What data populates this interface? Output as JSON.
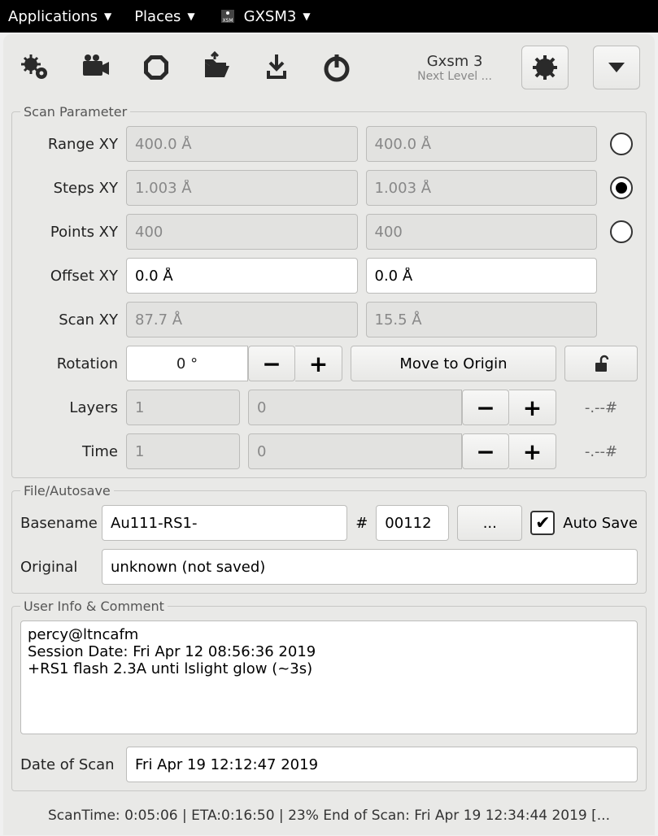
{
  "menubar": {
    "applications": "Applications",
    "places": "Places",
    "app": "GXSM3"
  },
  "header": {
    "title": "Gxsm 3",
    "subtitle": "Next Level ..."
  },
  "scan_parameter": {
    "legend": "Scan Parameter",
    "range_label": "Range XY",
    "range_x": "400.0 Å",
    "range_y": "400.0 Å",
    "steps_label": "Steps XY",
    "steps_x": "1.003 Å",
    "steps_y": "1.003 Å",
    "points_label": "Points XY",
    "points_x": "400",
    "points_y": "400",
    "offset_label": "Offset XY",
    "offset_x": "0.0 Å",
    "offset_y": "0.0 Å",
    "scan_label": "Scan XY",
    "scan_x": "87.7 Å",
    "scan_y": "15.5 Å",
    "rotation_label": "Rotation",
    "rotation_val": "0 °",
    "move_origin": "Move to Origin",
    "layers_label": "Layers",
    "layers_a": "1",
    "layers_b": "0",
    "layers_tail": "-.--#",
    "time_label": "Time",
    "time_a": "1",
    "time_b": "0",
    "time_tail": "-.--#"
  },
  "autosave": {
    "legend": "File/Autosave",
    "basename_label": "Basename",
    "basename": "Au111-RS1-",
    "hash": "#",
    "counter": "00112",
    "browse": "...",
    "autosave_label": "Auto Save",
    "original_label": "Original",
    "original": "unknown (not saved)"
  },
  "userinfo": {
    "legend": "User Info & Comment",
    "comment": "percy@ltncafm\nSession Date: Fri Apr 12 08:56:36 2019\n+RS1 flash 2.3A unti lslight glow (~3s)",
    "date_label": "Date of Scan",
    "date": "Fri Apr 19 12:12:47 2019"
  },
  "status": "ScanTime: 0:05:06 | ETA:0:16:50 | 23% End of Scan: Fri Apr 19 12:34:44 2019  [..."
}
